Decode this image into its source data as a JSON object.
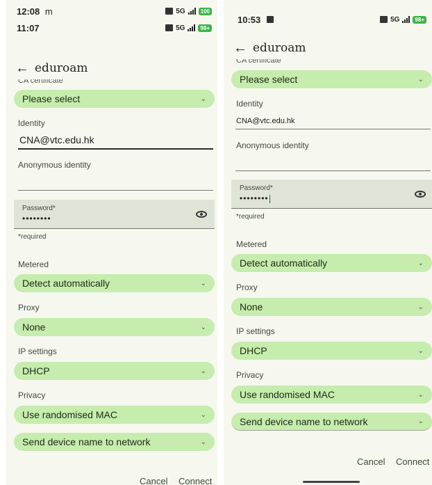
{
  "left": {
    "status_top": {
      "time": "12:08",
      "carrier_glyph": "m",
      "network": "5G",
      "battery": "100"
    },
    "status": {
      "time": "11:07",
      "network": "5G",
      "battery": "98+"
    },
    "title": "eduroam",
    "ca_certificate_value": "Please select",
    "identity_label": "Identity",
    "identity_value": "CNA@vtc.edu.hk",
    "anonymous_label": "Anonymous identity",
    "anonymous_value": "",
    "password_label": "Password*",
    "password_value": "••••••••",
    "required_note": "*required",
    "metered_label": "Metered",
    "metered_value": "Detect automatically",
    "proxy_label": "Proxy",
    "proxy_value": "None",
    "ip_label": "IP settings",
    "ip_value": "DHCP",
    "privacy_label": "Privacy",
    "privacy_value": "Use randomised MAC",
    "device_name_value": "Send device name to network",
    "cancel": "Cancel",
    "connect": "Connect"
  },
  "right": {
    "status": {
      "time": "10:53",
      "network": "5G",
      "battery": "98+"
    },
    "title": "eduroam",
    "ca_certificate_value": "Please select",
    "identity_label": "Identity",
    "identity_value": "CNA@vtc.edu.hk",
    "anonymous_label": "Anonymous identity",
    "anonymous_value": "",
    "password_label": "Password*",
    "password_value": "••••••••",
    "required_note": "*required",
    "metered_label": "Metered",
    "metered_value": "Detect automatically",
    "proxy_label": "Proxy",
    "proxy_value": "None",
    "ip_label": "IP settings",
    "ip_value": "DHCP",
    "privacy_label": "Privacy",
    "privacy_value": "Use randomised MAC",
    "device_name_value": "Send device name to network",
    "cancel": "Cancel",
    "connect": "Connect"
  },
  "icons": {
    "back": "back-arrow-icon",
    "chevron": "chevron-down-icon",
    "eye": "eye-icon",
    "signal": "signal-bars-icon",
    "sim": "sim-card-icon",
    "battery": "battery-icon"
  },
  "colors": {
    "dropdown_bg": "#c6ecae",
    "panel_bg": "#f6f8ef",
    "password_field_bg": "#dfe4d7",
    "battery_green": "#3db34a"
  }
}
